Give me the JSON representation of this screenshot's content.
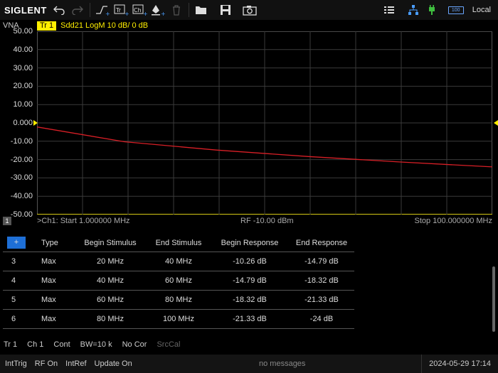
{
  "toolbar": {
    "logo": "SIGLENT",
    "local": "Local",
    "battery": "100",
    "icons": [
      "undo-icon",
      "redo-icon",
      "add-trace-icon",
      "trace-icon",
      "channel-icon",
      "marker-icon",
      "delete-icon",
      "open-folder-icon",
      "save-icon",
      "camera-icon",
      "menu-list-icon",
      "network-icon",
      "power-plug-icon",
      "battery-icon"
    ]
  },
  "trace": {
    "instrument": "VNA",
    "tr_label": "Tr 1",
    "info": "Sdd21  LogM  10 dB/ 0 dB"
  },
  "plot": {
    "y_ticks": [
      "50.00",
      "40.00",
      "30.00",
      "20.00",
      "10.00",
      "0.000",
      "-10.00",
      "-20.00",
      "-30.00",
      "-40.00",
      "-50.00"
    ],
    "ch_num": "1",
    "start": ">Ch1: Start 1.000000 MHz",
    "rf": "RF -10.00 dBm",
    "stop": "Stop 100.000000 MHz"
  },
  "chart_data": {
    "type": "line",
    "x": [
      1,
      20,
      40,
      60,
      80,
      100
    ],
    "series": [
      {
        "values": [
          -2.2,
          -10.26,
          -14.79,
          -18.32,
          -21.33,
          -24.0
        ],
        "color": "#d81f26"
      }
    ],
    "ylim": [
      -50,
      50
    ],
    "xlim": [
      1,
      100
    ],
    "grid": true
  },
  "table": {
    "add_label": "+",
    "headers": [
      "Type",
      "Begin Stimulus",
      "End Stimulus",
      "Begin Response",
      "End Response"
    ],
    "rows": [
      [
        "3",
        "Max",
        "20 MHz",
        "40 MHz",
        "-10.26 dB",
        "-14.79 dB"
      ],
      [
        "4",
        "Max",
        "40 MHz",
        "60 MHz",
        "-14.79 dB",
        "-18.32 dB"
      ],
      [
        "5",
        "Max",
        "60 MHz",
        "80 MHz",
        "-18.32 dB",
        "-21.33 dB"
      ],
      [
        "6",
        "Max",
        "80 MHz",
        "100 MHz",
        "-21.33 dB",
        "-24 dB"
      ]
    ]
  },
  "status1": [
    "Tr 1",
    "Ch 1",
    "Cont",
    "BW=10 k",
    "No Cor",
    "SrcCal"
  ],
  "status2": {
    "items": [
      "IntTrig",
      "RF On",
      "IntRef",
      "Update On"
    ],
    "message": "no messages",
    "time": "2024-05-29 17:14"
  },
  "colors": {
    "trace": "#d81f26",
    "accent": "#ffef00",
    "button": "#1e6fd6"
  }
}
